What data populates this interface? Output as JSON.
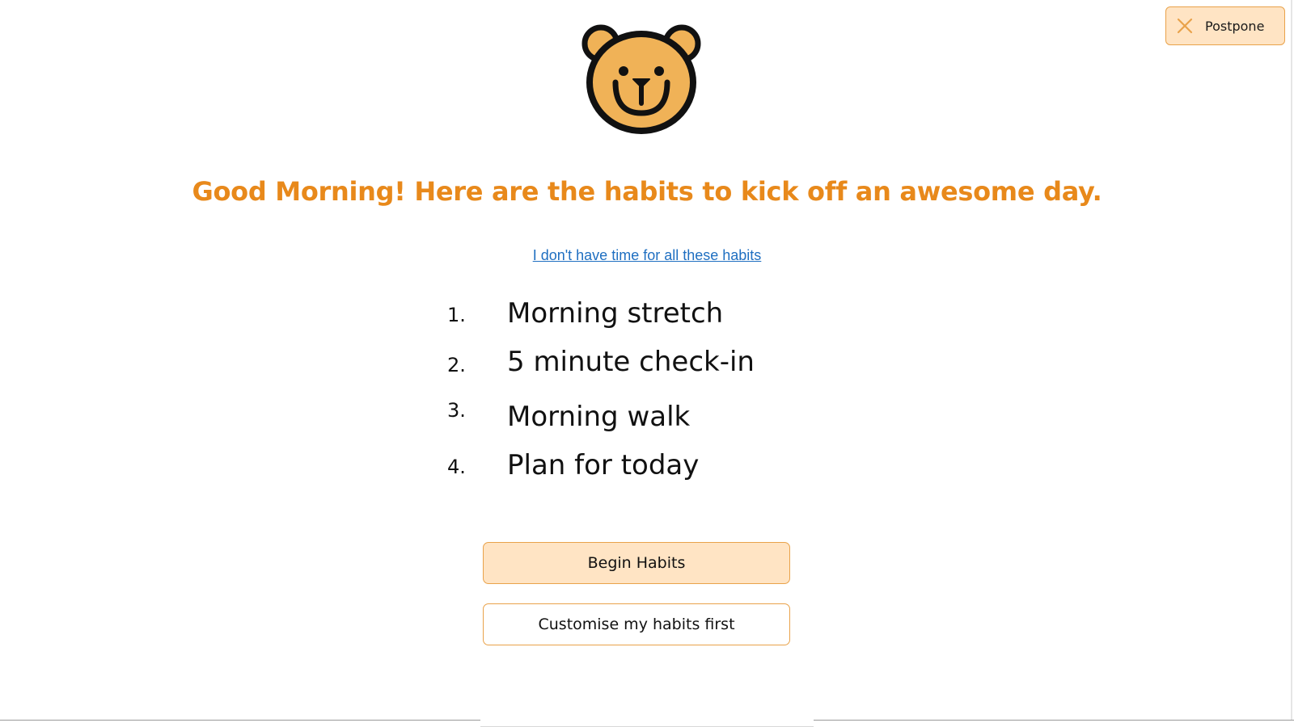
{
  "header": {
    "postpone_label": "Postpone"
  },
  "main": {
    "headline": "Good Morning! Here are the habits to kick off an awesome day.",
    "no_time_link": "I don't have time for all these habits",
    "habits": [
      {
        "number": "1.",
        "label": "Morning stretch"
      },
      {
        "number": "2.",
        "label": "5 minute check-in"
      },
      {
        "number": "3.",
        "label": "Morning walk"
      },
      {
        "number": "4.",
        "label": "Plan for today"
      }
    ],
    "begin_label": "Begin Habits",
    "customise_label": "Customise my habits first"
  },
  "icons": {
    "mascot": "bear-face-icon",
    "postpone": "close-icon"
  },
  "colors": {
    "accent": "#e8891b",
    "button_fill": "#ffe4c4",
    "button_border": "#e9a24a",
    "link": "#1f6fc1",
    "bear_fur": "#f0b257"
  }
}
